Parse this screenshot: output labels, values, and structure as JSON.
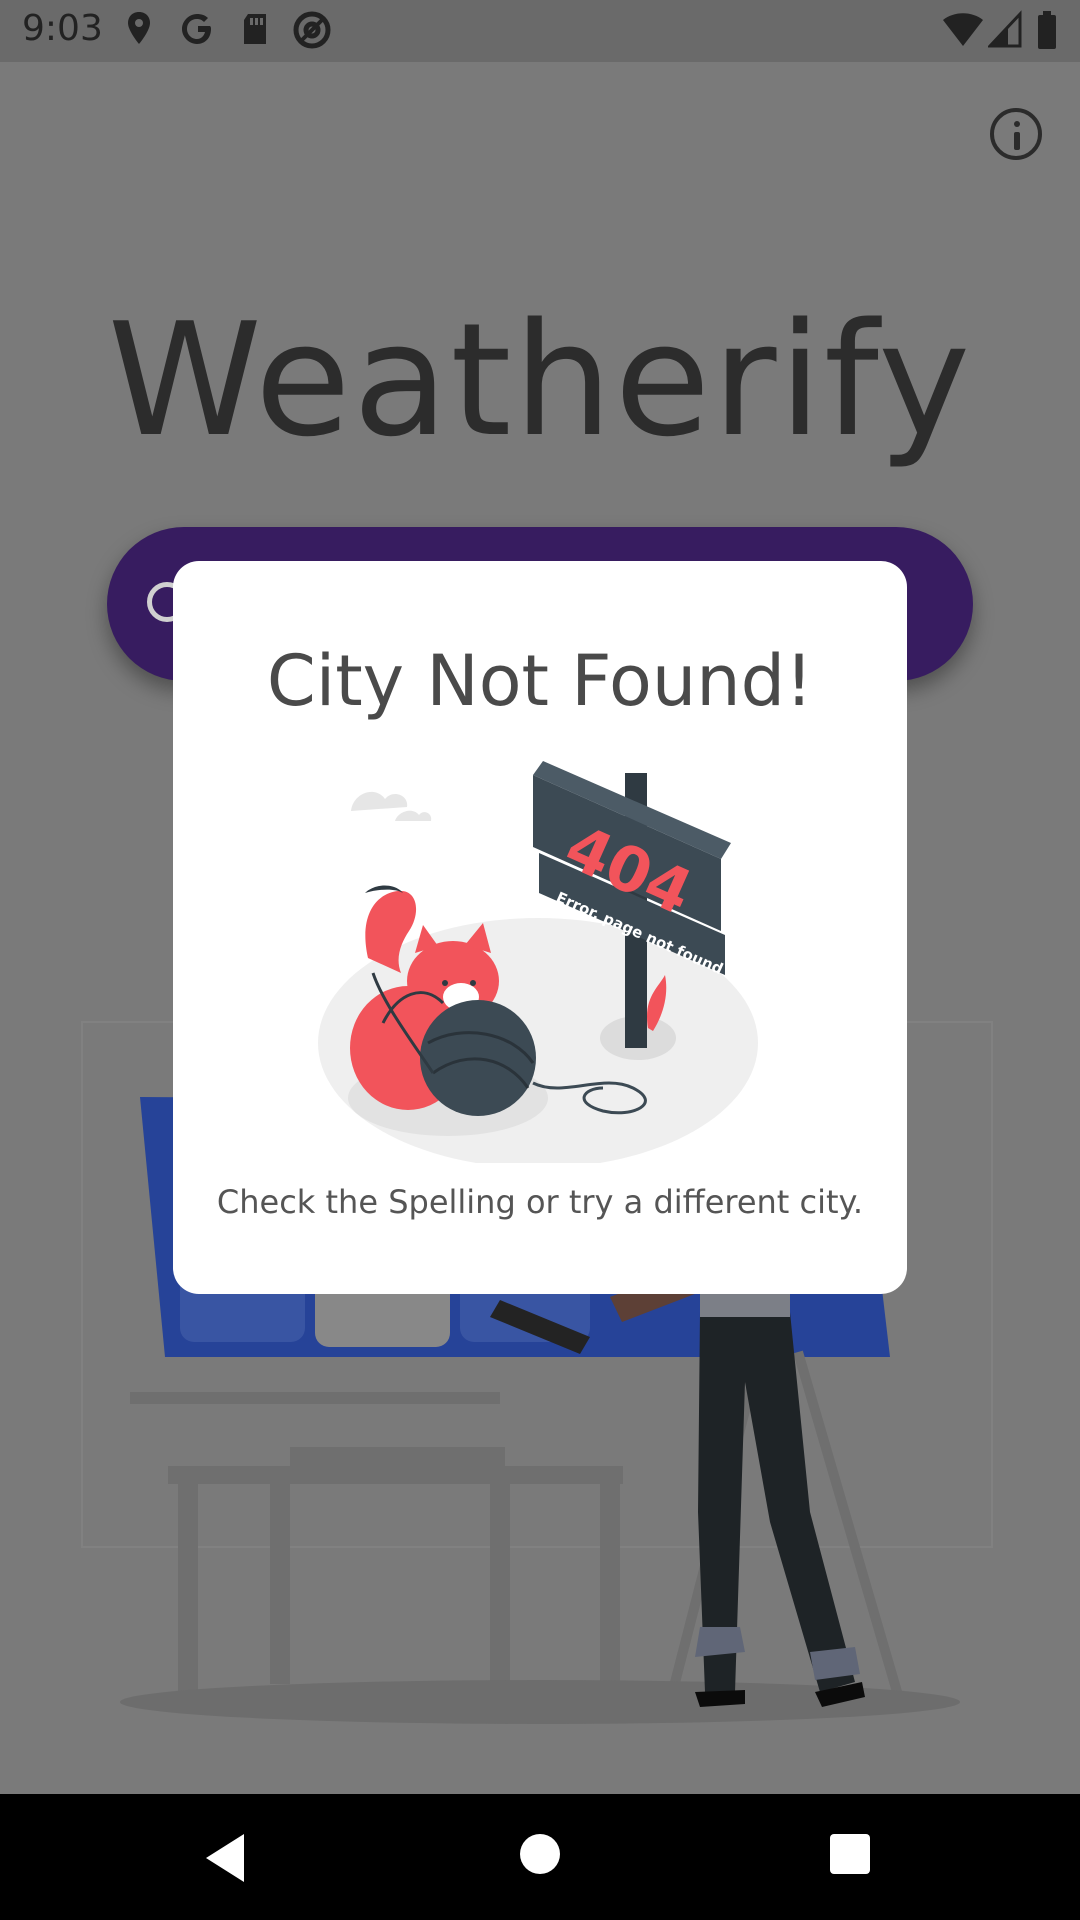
{
  "status_bar": {
    "time": "9:03",
    "left_icons": [
      "location-icon",
      "google-icon",
      "sd-card-icon",
      "at-sign-icon"
    ],
    "right_icons": [
      "wifi-icon",
      "signal-icon",
      "battery-icon"
    ]
  },
  "app": {
    "title": "Weatherify",
    "info_icon": "info-icon",
    "search_icon": "search-icon",
    "accent_color": "#371c60"
  },
  "dialog": {
    "title": "City Not Found!",
    "illustration": {
      "sign_number": "404",
      "sign_text": "Error, page not found"
    },
    "message": "Check the Spelling or try a different city."
  },
  "nav_bar": {
    "icons": [
      "back-icon",
      "home-icon",
      "recents-icon"
    ]
  }
}
